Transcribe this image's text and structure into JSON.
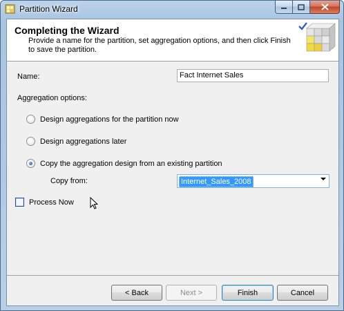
{
  "window": {
    "title": "Partition Wizard"
  },
  "icons": {
    "app": "cube-wizard-icon",
    "header_art": "aggregation-cube-icon"
  },
  "header": {
    "title": "Completing the Wizard",
    "description": "Provide a name for the partition, set aggregation options, and then click Finish to save the partition."
  },
  "form": {
    "name_label": "Name:",
    "name_value": "Fact Internet Sales",
    "aggregation_label": "Aggregation options:",
    "options": [
      {
        "label": "Design aggregations for the partition now",
        "selected": false
      },
      {
        "label": "Design aggregations later",
        "selected": false
      },
      {
        "label": "Copy the aggregation design from an existing partition",
        "selected": true
      }
    ],
    "copy_from_label": "Copy from:",
    "copy_from_value": "Internet_Sales_2008",
    "process_now_label": "Process Now",
    "process_now_checked": false
  },
  "buttons": {
    "back": "< Back",
    "next": "Next >",
    "finish": "Finish",
    "cancel": "Cancel"
  },
  "colors": {
    "accent": "#3399ff",
    "title_bar": "#bcd3ea"
  }
}
